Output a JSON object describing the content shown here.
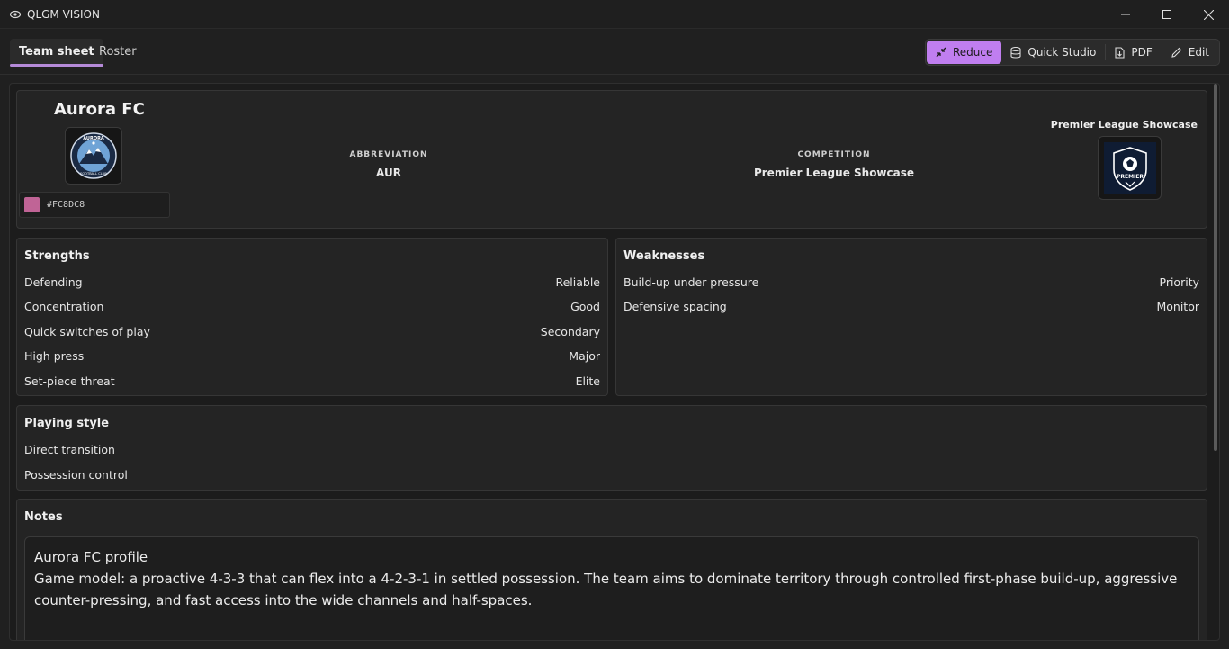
{
  "window": {
    "title": "QLGM VISION"
  },
  "tabs": [
    {
      "label": "Team sheet"
    },
    {
      "label": "Roster"
    }
  ],
  "actions": {
    "reduce": "Reduce",
    "quick_studio": "Quick Studio",
    "pdf": "PDF",
    "edit": "Edit"
  },
  "team": {
    "name": "Aurora FC",
    "color_hex": "#FC8DC8",
    "abbreviation_label": "ABBREVIATION",
    "abbreviation": "AUR",
    "competition_label": "COMPETITION",
    "competition": "Premier League Showcase",
    "competition_header": "Premier League Showcase",
    "logo_text_top": "AURORA",
    "logo_text_bottom": "FOOTBALL CLUB",
    "comp_logo_text": "PREMIER"
  },
  "strengths": {
    "title": "Strengths",
    "items": [
      {
        "name": "Defending",
        "level": "Reliable"
      },
      {
        "name": "Concentration",
        "level": "Good"
      },
      {
        "name": "Quick switches of play",
        "level": "Secondary"
      },
      {
        "name": "High press",
        "level": "Major"
      },
      {
        "name": "Set-piece threat",
        "level": "Elite"
      }
    ]
  },
  "weaknesses": {
    "title": "Weaknesses",
    "items": [
      {
        "name": "Build-up under pressure",
        "level": "Priority"
      },
      {
        "name": "Defensive spacing",
        "level": "Monitor"
      }
    ]
  },
  "playing_style": {
    "title": "Playing style",
    "items": [
      "Direct transition",
      "Possession control"
    ]
  },
  "notes": {
    "title": "Notes",
    "heading": "Aurora FC profile",
    "body": "Game model: a proactive 4-3-3 that can flex into a 4-2-3-1 in settled possession. The team aims to dominate territory through controlled first-phase build-up, aggressive counter-pressing, and fast access into the wide channels and half-spaces."
  },
  "colors": {
    "accent": "#C07EF0",
    "team_swatch": "#C06496",
    "background": "#202020",
    "card": "#242424"
  }
}
